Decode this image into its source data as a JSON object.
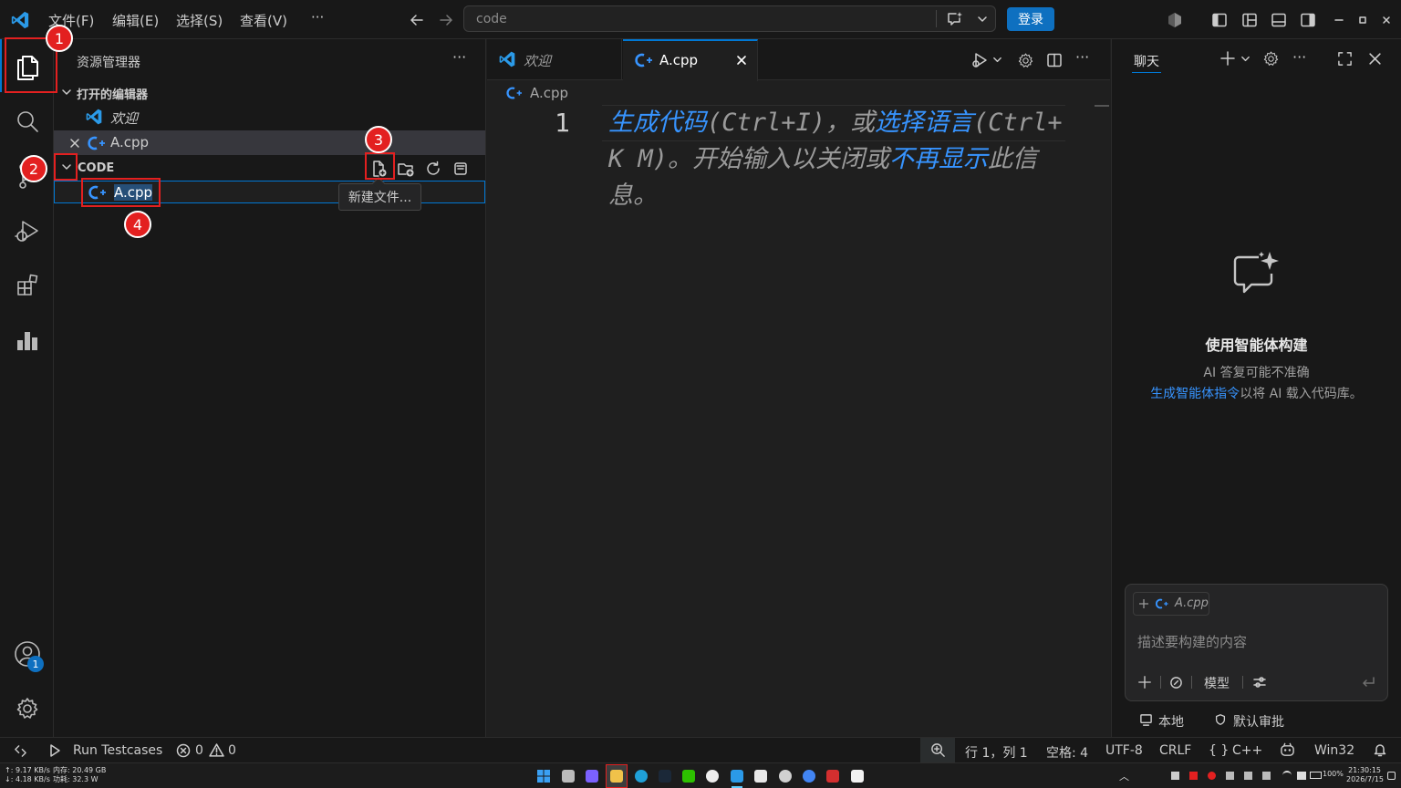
{
  "menu": {
    "file": "文件(F)",
    "edit": "编辑(E)",
    "select": "选择(S)",
    "view": "查看(V)",
    "more": "···"
  },
  "command_center": {
    "text": "code"
  },
  "login": "登录",
  "sidebar": {
    "title": "资源管理器",
    "open_editors_label": "打开的编辑器",
    "open_editors": [
      {
        "label": "欢迎",
        "icon": "vscode-icon"
      },
      {
        "label": "A.cpp",
        "icon": "cpp-icon"
      }
    ],
    "folder_label": "CODE",
    "file_input_value": "A.cpp",
    "tooltip": "新建文件..."
  },
  "tabs": [
    {
      "label": "欢迎",
      "icon": "vscode-icon"
    },
    {
      "label": "A.cpp",
      "icon": "cpp-icon",
      "active": true
    }
  ],
  "editor": {
    "breadcrumb": "A.cpp",
    "line_number": "1",
    "hint_parts": [
      {
        "text": "生成代码",
        "link": true
      },
      {
        "text": "(Ctrl+I)，或",
        "link": false
      },
      {
        "text": "选择语言",
        "link": true
      },
      {
        "text": "(Ctrl+K M)。开始输入以关闭或",
        "link": false
      },
      {
        "text": "不再显示",
        "link": true
      },
      {
        "text": "此信息。",
        "link": false
      }
    ]
  },
  "chat": {
    "tab_label": "聊天",
    "heading": "使用智能体构建",
    "note": "AI 答复可能不准确",
    "link_text": "生成智能体指令",
    "link_suffix": "以将 AI 载入代码库。",
    "context_chip": "A.cpp",
    "input_placeholder": "描述要构建的内容",
    "model_label": "模型",
    "local_label": "本地",
    "approval_label": "默认审批"
  },
  "status": {
    "run_testcases": "Run Testcases",
    "errors": "0",
    "warnings": "0",
    "position": "行 1，列 1",
    "spaces": "空格: 4",
    "encoding": "UTF-8",
    "eol": "CRLF",
    "language": "C++",
    "platform": "Win32"
  },
  "taskbar": {
    "net_up": "↑: 9.17 KB/s",
    "net_down": "↓: 4.18 KB/s",
    "memory": "内存: 20.49 GB",
    "power": "功耗: 32.3 W",
    "battery": "100%",
    "time": "21:30:15",
    "date": "2026/7/15"
  },
  "annotations": [
    "1",
    "2",
    "3",
    "4"
  ],
  "account_badge": "1",
  "colors": {
    "accent": "#0e70c0",
    "link": "#3794ff",
    "annotation_red": "#e32020",
    "background": "#1f1f1f",
    "panel": "#181818"
  }
}
